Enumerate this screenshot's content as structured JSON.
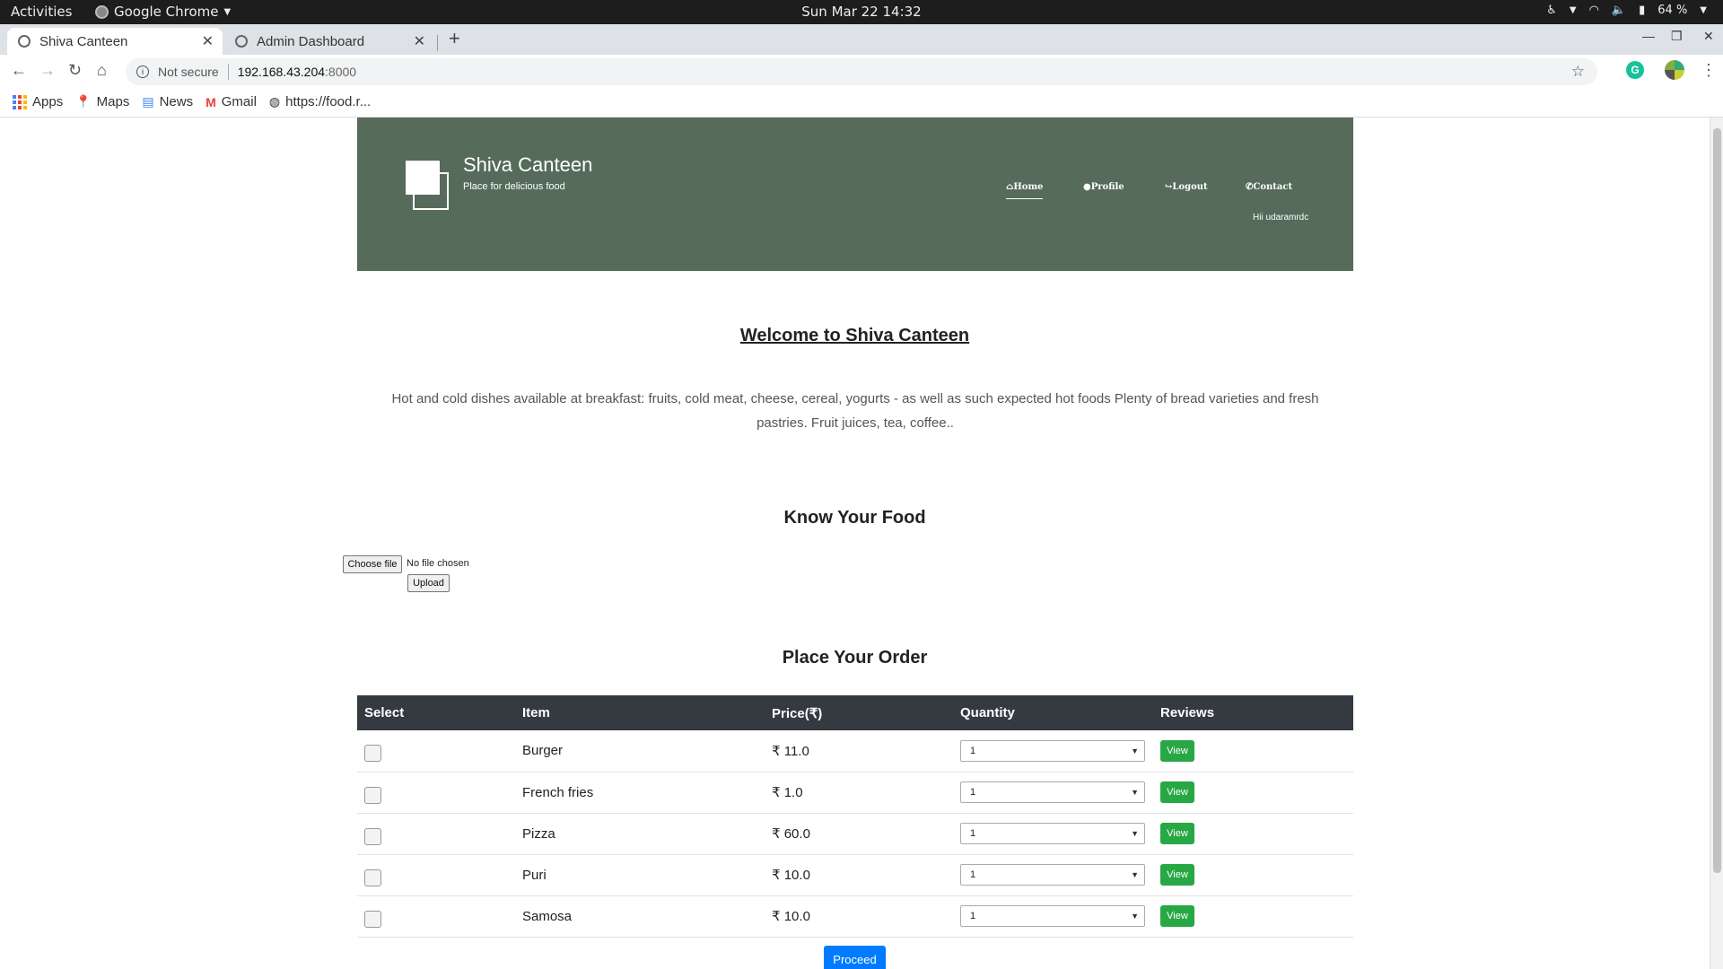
{
  "system_bar": {
    "activities": "Activities",
    "app_name": "Google Chrome",
    "clock": "Sun Mar 22  14:32",
    "battery": "64 %"
  },
  "browser": {
    "tabs": [
      {
        "title": "Shiva Canteen",
        "active": true
      },
      {
        "title": "Admin Dashboard",
        "active": false
      }
    ],
    "security": "Not secure",
    "url_host": "192.168.43.204",
    "url_port": ":8000",
    "bookmarks": [
      {
        "label": "Apps",
        "icon": "apps-grid-icon"
      },
      {
        "label": "Maps",
        "icon": "maps-icon"
      },
      {
        "label": "News",
        "icon": "news-icon"
      },
      {
        "label": "Gmail",
        "icon": "gmail-icon"
      },
      {
        "label": "https://food.r...",
        "icon": "globe-icon"
      }
    ]
  },
  "site": {
    "title": "Shiva Canteen",
    "tagline": "Place for delicious food",
    "nav": {
      "home": "Home",
      "profile": "Profile",
      "logout": "Logout",
      "contact": "Contact"
    },
    "greeting": "Hii udaramrdc",
    "header_color": "#566b5a"
  },
  "welcome": {
    "heading": "Welcome to Shiva Canteen",
    "text": "Hot and cold dishes available at breakfast: fruits, cold meat, cheese, cereal, yogurts - as well as such expected hot foods Plenty of bread varieties and fresh pastries. Fruit juices, tea, coffee.."
  },
  "know_food": {
    "heading": "Know Your Food",
    "choose_label": "Choose file",
    "file_status": "No file chosen",
    "upload_label": "Upload"
  },
  "order": {
    "heading": "Place Your Order",
    "columns": [
      "Select",
      "Item",
      "Price(₹)",
      "Quantity",
      "Reviews"
    ],
    "rows": [
      {
        "item": "Burger",
        "price": "₹ 11.0",
        "qty": "1",
        "review": "View"
      },
      {
        "item": "French fries",
        "price": "₹ 1.0",
        "qty": "1",
        "review": "View"
      },
      {
        "item": "Pizza",
        "price": "₹ 60.0",
        "qty": "1",
        "review": "View"
      },
      {
        "item": "Puri",
        "price": "₹ 10.0",
        "qty": "1",
        "review": "View"
      },
      {
        "item": "Samosa",
        "price": "₹ 10.0",
        "qty": "1",
        "review": "View"
      }
    ],
    "proceed_label": "Proceed",
    "colors": {
      "header": "#343a40",
      "view": "#28a745",
      "proceed": "#007bff"
    }
  }
}
